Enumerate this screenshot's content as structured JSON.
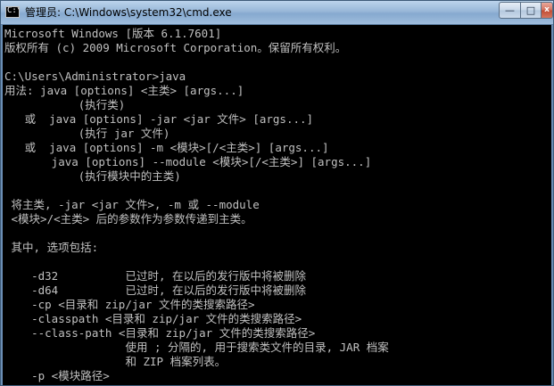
{
  "window": {
    "title": "管理员: C:\\Windows\\system32\\cmd.exe",
    "app_icon": "cmd-console-icon",
    "controls": {
      "minimize": "—",
      "maximize": "□",
      "close": "x"
    }
  },
  "console": {
    "text_color": "#c0c0c0",
    "background_color": "#000000",
    "lines": [
      "Microsoft Windows [版本 6.1.7601]",
      "版权所有 (c) 2009 Microsoft Corporation。保留所有权利。",
      "",
      "C:\\Users\\Administrator>java",
      "用法: java [options] <主类> [args...]",
      "           (执行类)",
      "   或  java [options] -jar <jar 文件> [args...]",
      "           (执行 jar 文件)",
      "   或  java [options] -m <模块>[/<主类>] [args...]",
      "       java [options] --module <模块>[/<主类>] [args...]",
      "           (执行模块中的主类)",
      "",
      " 将主类, -jar <jar 文件>, -m 或 --module",
      " <模块>/<主类> 后的参数作为参数传递到主类。",
      "",
      " 其中, 选项包括:",
      "",
      "    -d32          已过时, 在以后的发行版中将被删除",
      "    -d64          已过时, 在以后的发行版中将被删除",
      "    -cp <目录和 zip/jar 文件的类搜索路径>",
      "    -classpath <目录和 zip/jar 文件的类搜索路径>",
      "    --class-path <目录和 zip/jar 文件的类搜索路径>",
      "                  使用 ; 分隔的, 用于搜索类文件的目录, JAR 档案",
      "                  和 ZIP 档案列表。",
      "    -p <模块路径>"
    ]
  }
}
